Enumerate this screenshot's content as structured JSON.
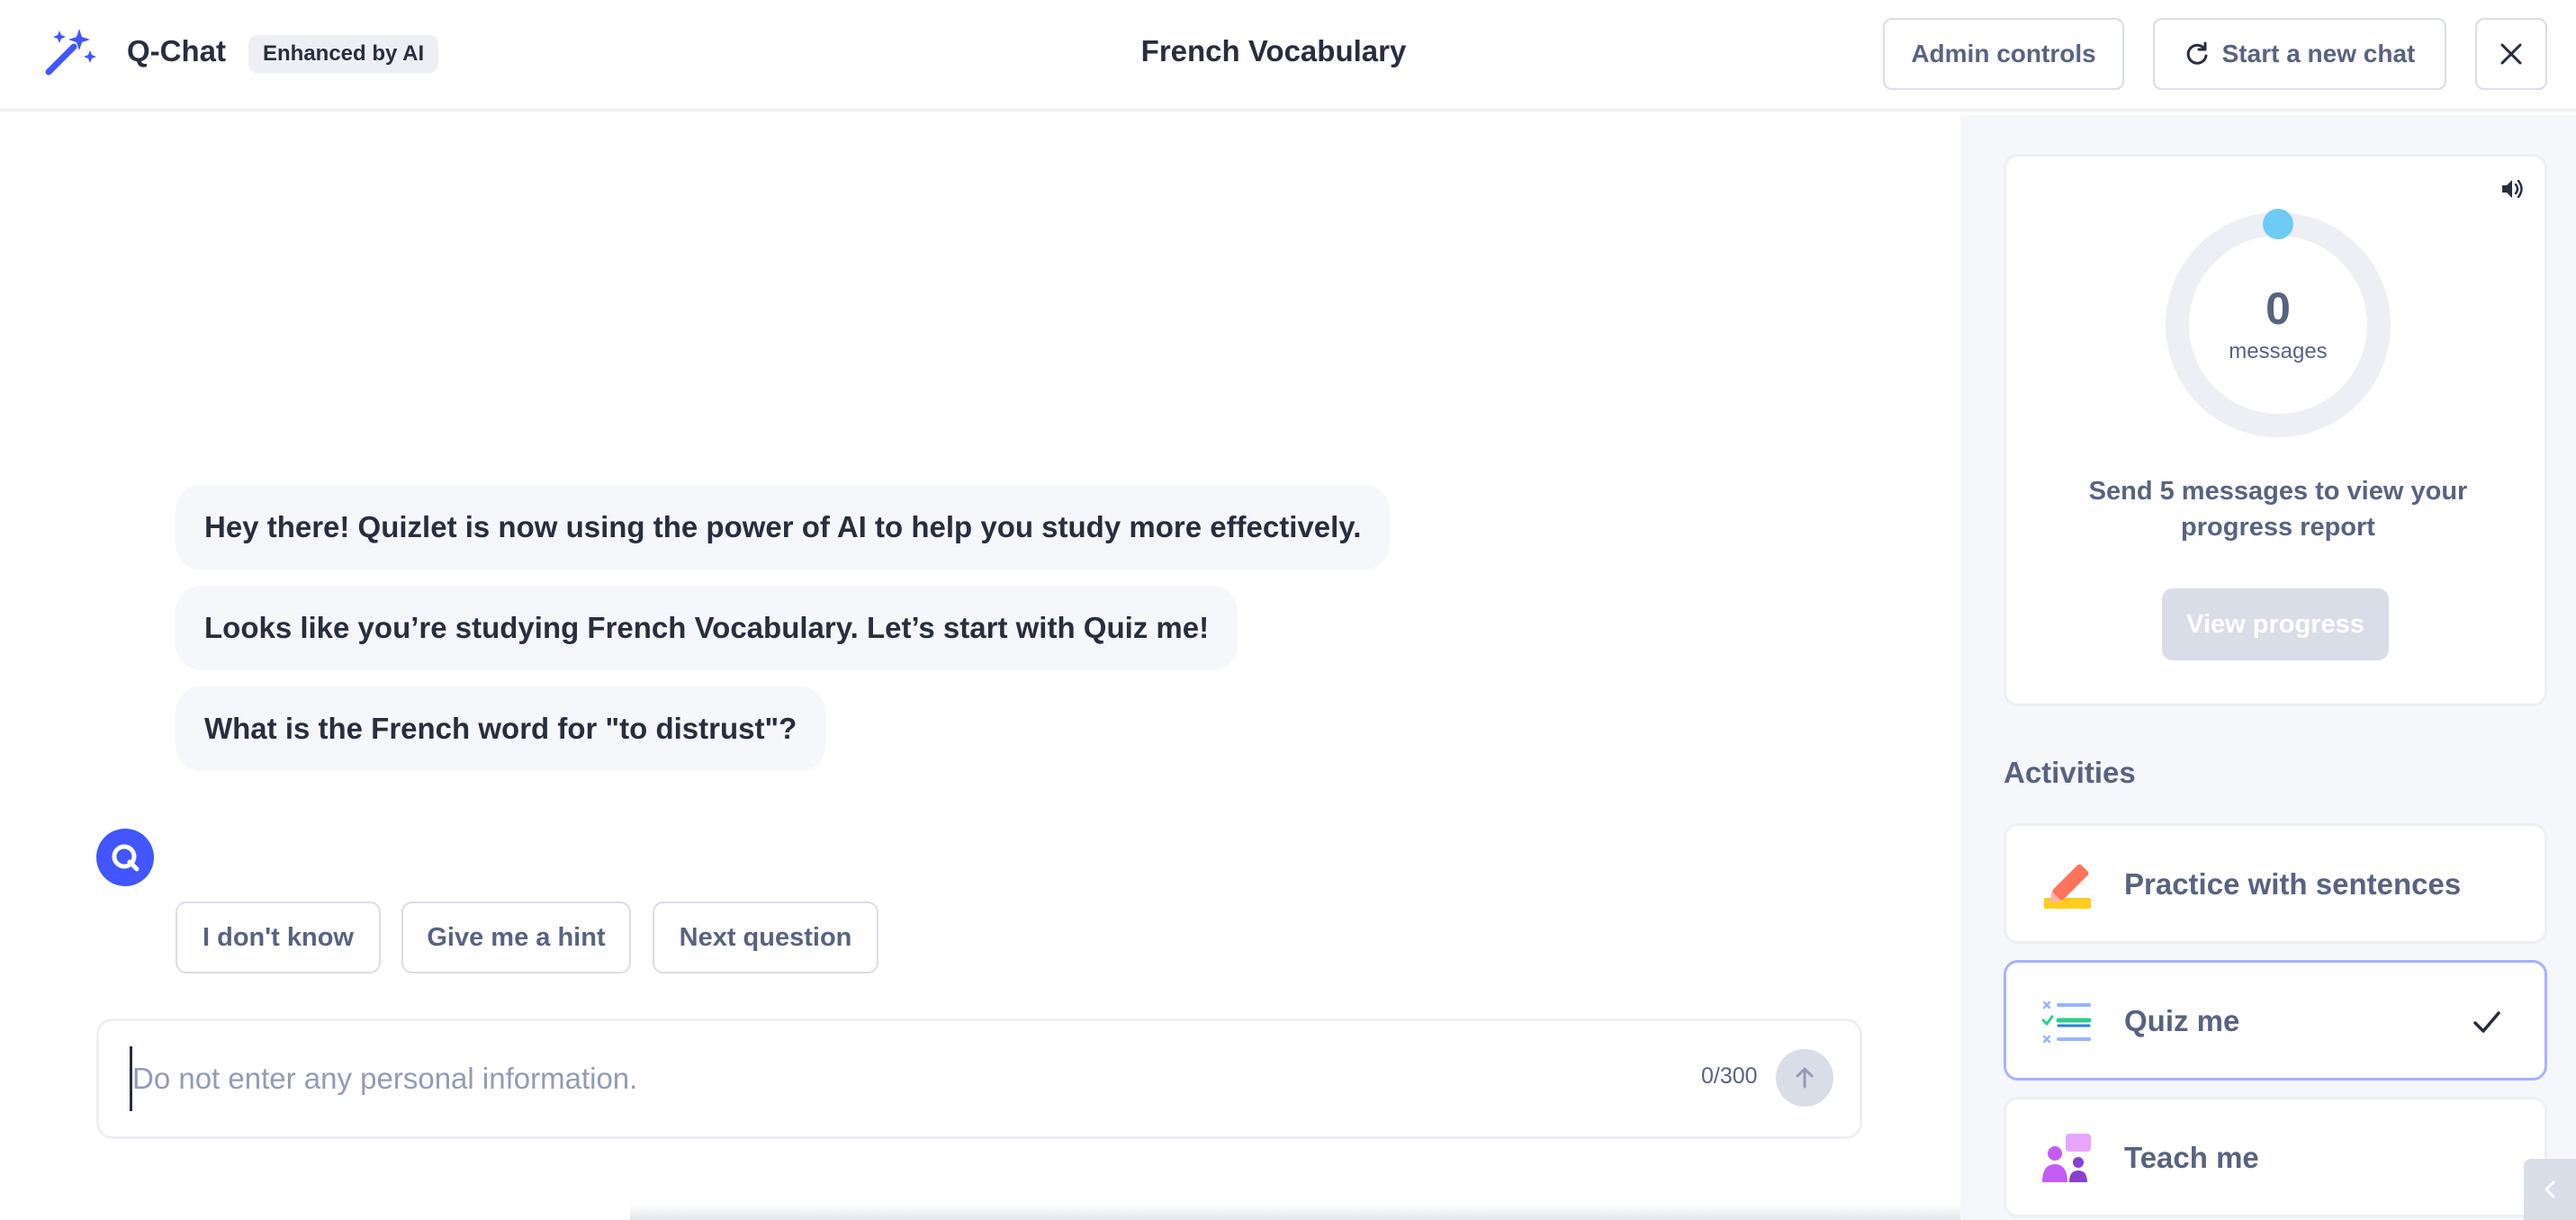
{
  "header": {
    "app_name": "Q-Chat",
    "badge": "Enhanced by AI",
    "title": "French Vocabulary",
    "admin_label": "Admin controls",
    "new_chat_label": "Start a new chat",
    "icons": [
      "magic-wand-icon",
      "refresh-icon",
      "close-icon"
    ]
  },
  "chat": {
    "messages": [
      "Hey there! Quizlet is now using the power of AI to help you study more effectively.",
      "Looks like you’re studying French Vocabulary. Let’s start with Quiz me!",
      "What is the French word for \"to distrust\"?"
    ],
    "quick_replies": [
      "I don't know",
      "Give me a hint",
      "Next question"
    ],
    "input": {
      "placeholder": "Do not enter any personal information.",
      "value": "",
      "char_count": "0/300"
    }
  },
  "sidebar": {
    "progress": {
      "count": "0",
      "count_label": "messages",
      "text": "Send 5 messages to view your progress report",
      "button_label": "View progress"
    },
    "activities_heading": "Activities",
    "activities": [
      {
        "label": "Practice with sentences",
        "icon": "pencil-icon",
        "selected": false
      },
      {
        "label": "Quiz me",
        "icon": "checklist-icon",
        "selected": true
      },
      {
        "label": "Teach me",
        "icon": "teacher-icon",
        "selected": false
      }
    ]
  },
  "colors": {
    "accent": "#4255ff",
    "progress_dot": "#6ecbf5",
    "text_primary": "#282e3e",
    "text_secondary": "#586380",
    "border": "#d9dde8",
    "sidebar_bg": "#f6f7fb",
    "selected_border": "#a8b1ff"
  }
}
